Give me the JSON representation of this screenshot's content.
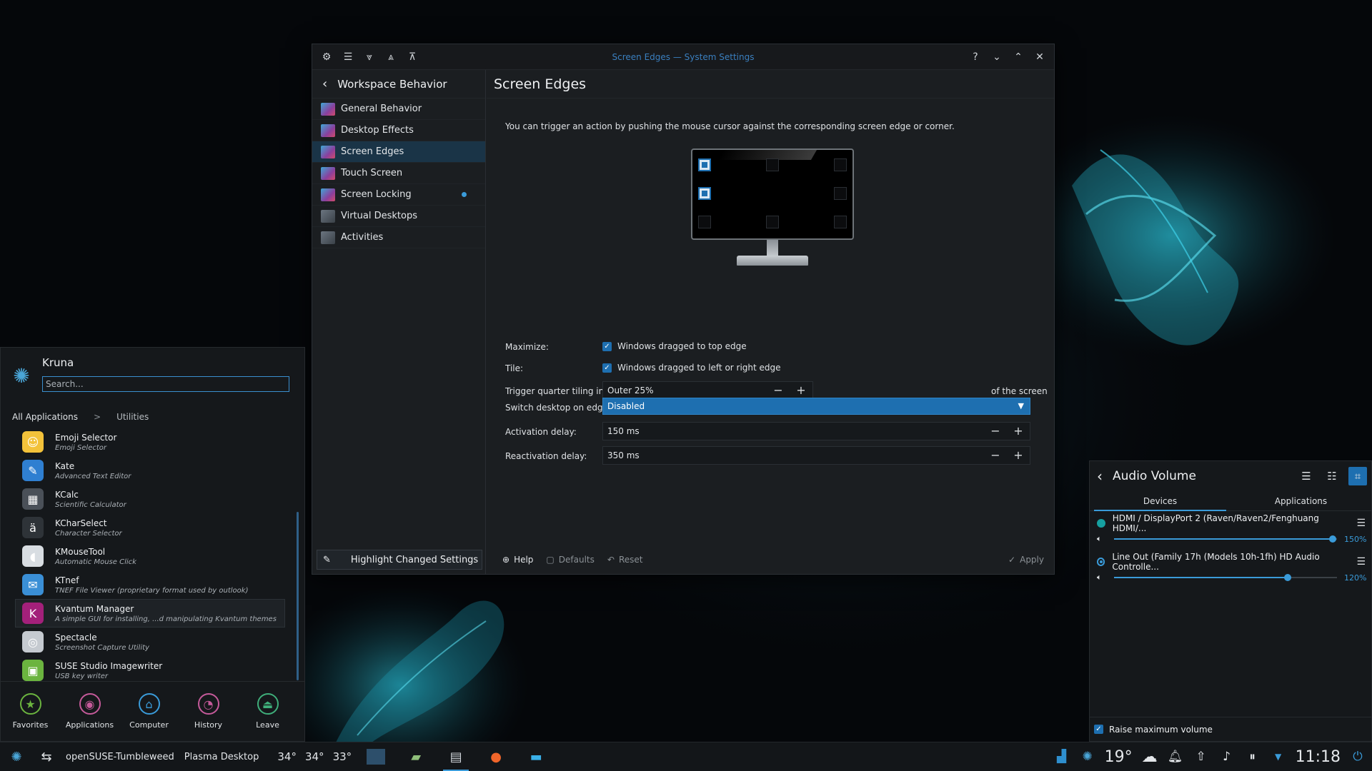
{
  "window": {
    "title": "Screen Edges — System Settings",
    "sidebar_title": "Workspace Behavior",
    "sidebar_items": [
      {
        "label": "General Behavior"
      },
      {
        "label": "Desktop Effects"
      },
      {
        "label": "Screen Edges"
      },
      {
        "label": "Touch Screen"
      },
      {
        "label": "Screen Locking"
      },
      {
        "label": "Virtual Desktops"
      },
      {
        "label": "Activities"
      }
    ],
    "highlight_label": "Highlight Changed Settings",
    "page_title": "Screen Edges",
    "description": "You can trigger an action by pushing the mouse cursor against the corresponding screen edge or corner.",
    "maximize_label": "Maximize:",
    "maximize_option": "Windows dragged to top edge",
    "tile_label": "Tile:",
    "tile_option": "Windows dragged to left or right edge",
    "quarter_label": "Trigger quarter tiling in:",
    "quarter_value": "Outer 25%",
    "quarter_suffix": "of the screen",
    "switch_label": "Switch desktop on edge:",
    "switch_value": "Disabled",
    "activation_label": "Activation delay:",
    "activation_value": "150 ms",
    "reactivation_label": "Reactivation delay:",
    "reactivation_value": "350 ms",
    "help_label": "Help",
    "defaults_label": "Defaults",
    "reset_label": "Reset",
    "apply_label": "Apply"
  },
  "kickoff": {
    "user": "Kruna",
    "search_placeholder": "Search...",
    "crumb_root": "All Applications",
    "crumb_sep": ">",
    "crumb_sub": "Utilities",
    "apps": [
      {
        "name": "Emoji Selector",
        "desc": "Emoji Selector",
        "icon": "emoji-icon",
        "color": "#f3c23a"
      },
      {
        "name": "Kate",
        "desc": "Advanced Text Editor",
        "icon": "kate-icon",
        "color": "#2f7fd1"
      },
      {
        "name": "KCalc",
        "desc": "Scientific Calculator",
        "icon": "calculator-icon",
        "color": "#4a5058"
      },
      {
        "name": "KCharSelect",
        "desc": "Character Selector",
        "icon": "charselect-icon",
        "color": "#2e3338"
      },
      {
        "name": "KMouseTool",
        "desc": "Automatic Mouse Click",
        "icon": "mouse-icon",
        "color": "#d8dde2"
      },
      {
        "name": "KTnef",
        "desc": "TNEF File Viewer (proprietary format used by outlook)",
        "icon": "ktnef-icon",
        "color": "#3a8fd6"
      },
      {
        "name": "Kvantum Manager",
        "desc": "A simple GUI for installing, ...d manipulating Kvantum themes",
        "icon": "kvantum-icon",
        "color": "#a3207a"
      },
      {
        "name": "Spectacle",
        "desc": "Screenshot Capture Utility",
        "icon": "spectacle-icon",
        "color": "#c5cad0"
      },
      {
        "name": "SUSE Studio Imagewriter",
        "desc": "USB key writer",
        "icon": "imagewriter-icon",
        "color": "#6bb43f"
      }
    ],
    "tabs": [
      {
        "label": "Favorites",
        "icon": "favorites-icon"
      },
      {
        "label": "Applications",
        "icon": "applications-icon"
      },
      {
        "label": "Computer",
        "icon": "computer-icon"
      },
      {
        "label": "History",
        "icon": "history-icon"
      },
      {
        "label": "Leave",
        "icon": "leave-icon"
      }
    ]
  },
  "audio": {
    "title": "Audio Volume",
    "tab_devices": "Devices",
    "tab_applications": "Applications",
    "devices": [
      {
        "name": "HDMI / DisplayPort 2 (Raven/Raven2/Fenghuang HDMI/...",
        "volume_label": "150%",
        "volume_fraction": 0.98
      },
      {
        "name": "Line Out (Family 17h (Models 10h-1fh) HD Audio Controlle...",
        "volume_label": "120%",
        "volume_fraction": 0.78
      }
    ],
    "raise_label": "Raise maximum volume"
  },
  "panel": {
    "distro": "openSUSE-Tumbleweed",
    "desktop": "Plasma Desktop",
    "temps": [
      "34°",
      "34°",
      "33°"
    ],
    "weather": "19°",
    "clock": "11:18"
  },
  "colors": {
    "accent": "#1e6fb0",
    "highlight": "#3a9bd9",
    "window_bg": "#1b1e21"
  }
}
